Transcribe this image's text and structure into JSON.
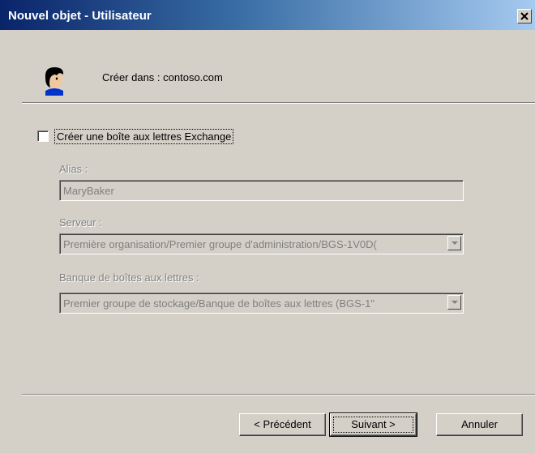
{
  "window": {
    "title": "Nouvel objet - Utilisateur",
    "close_icon": "close-icon"
  },
  "header": {
    "icon": "user-icon",
    "create_in_text": "Créer dans : contoso.com"
  },
  "mailbox": {
    "checkbox_label": "Créer une boîte aux lettres Exchange",
    "checked": false,
    "alias_label": "Alias :",
    "alias_value": "MaryBaker",
    "server_label": "Serveur :",
    "server_value": "Première organisation/Premier groupe d'administration/BGS-1V0D(",
    "store_label": "Banque de boîtes aux lettres :",
    "store_value": "Premier groupe de stockage/Banque de boîtes aux lettres (BGS-1\""
  },
  "buttons": {
    "back": "< Précédent",
    "next": "Suivant >",
    "cancel": "Annuler"
  }
}
